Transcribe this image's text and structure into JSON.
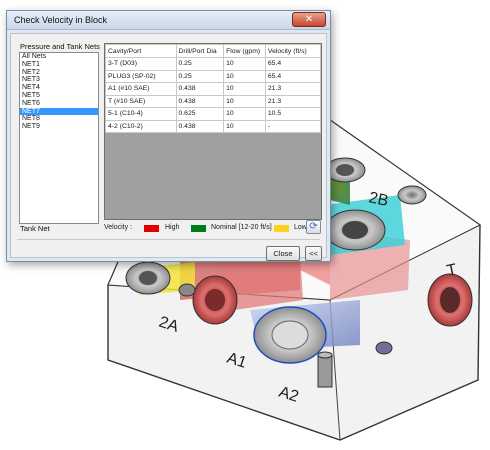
{
  "dialog": {
    "title": "Check Velocity in Block",
    "close_glyph": "✕",
    "nets_label": "Pressure and Tank Nets",
    "nets": [
      "All Nets",
      "NET1",
      "NET2",
      "NET3",
      "NET4",
      "NET5",
      "NET6",
      "NET7",
      "NET8",
      "NET9"
    ],
    "selected_net": "NET7",
    "tank_net_label": "Tank Net",
    "columns": [
      "Cavity/Port",
      "Drill/Port Dia",
      "Flow (gpm)",
      "Velocity (ft/s)"
    ],
    "rows": [
      [
        "3-T  (D03)",
        "0.25",
        "10",
        "65.4"
      ],
      [
        "PLUG3  (SP-02)",
        "0.25",
        "10",
        "65.4"
      ],
      [
        "A1  (#10 SAE)",
        "0.438",
        "10",
        "21.3"
      ],
      [
        "T  (#10 SAE)",
        "0.438",
        "10",
        "21.3"
      ],
      [
        "5-1  (C10-4)",
        "0.625",
        "10",
        "10.5"
      ],
      [
        "4-2  (C10-2)",
        "0.438",
        "10",
        "-"
      ]
    ],
    "velocity_label": "Velocity :",
    "legend": [
      {
        "label": "High",
        "color": "#e00000"
      },
      {
        "label": "Nominal [12-20 ft/s]",
        "color": "#007a1e"
      },
      {
        "label": "Low",
        "color": "#ffd21a"
      }
    ],
    "refresh_icon": "refresh-icon",
    "close_button_label": "Close",
    "collapse_button_label": "<<"
  },
  "scene": {
    "port_labels": [
      "2B",
      "2A",
      "A1",
      "A2",
      "T"
    ]
  }
}
